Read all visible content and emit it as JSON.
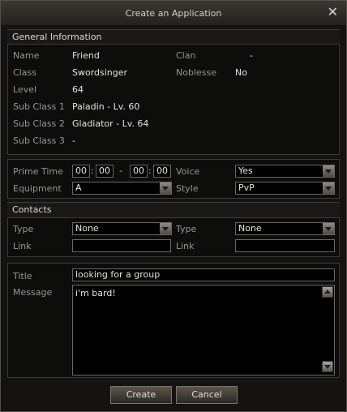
{
  "window": {
    "title": "Create an Application",
    "close_glyph": "✕"
  },
  "general": {
    "heading": "General Information",
    "name_label": "Name",
    "name_value": "Friend",
    "clan_label": "Clan",
    "clan_value": "-",
    "class_label": "Class",
    "class_value": "Swordsinger",
    "noblesse_label": "Noblesse",
    "noblesse_value": "No",
    "level_label": "Level",
    "level_value": "64",
    "sub1_label": "Sub Class 1",
    "sub1_value": "Paladin - Lv. 60",
    "sub2_label": "Sub Class 2",
    "sub2_value": "Gladiator - Lv. 64",
    "sub3_label": "Sub Class 3",
    "sub3_value": "-"
  },
  "prefs": {
    "prime_label": "Prime Time",
    "prime": {
      "h1": "00",
      "m1": "00",
      "h2": "00",
      "m2": "00",
      "colon": ":",
      "dash": "-"
    },
    "voice_label": "Voice",
    "voice_value": "Yes",
    "equipment_label": "Equipment",
    "equipment_value": "A",
    "style_label": "Style",
    "style_value": "PvP"
  },
  "contacts": {
    "heading": "Contacts",
    "type1_label": "Type",
    "type1_value": "None",
    "type2_label": "Type",
    "type2_value": "None",
    "link1_label": "Link",
    "link1_value": "",
    "link2_label": "Link",
    "link2_value": ""
  },
  "message": {
    "title_label": "Title",
    "title_value": "looking for a group",
    "message_label": "Message",
    "message_value": "i'm bard!"
  },
  "buttons": {
    "create": "Create",
    "cancel": "Cancel"
  }
}
